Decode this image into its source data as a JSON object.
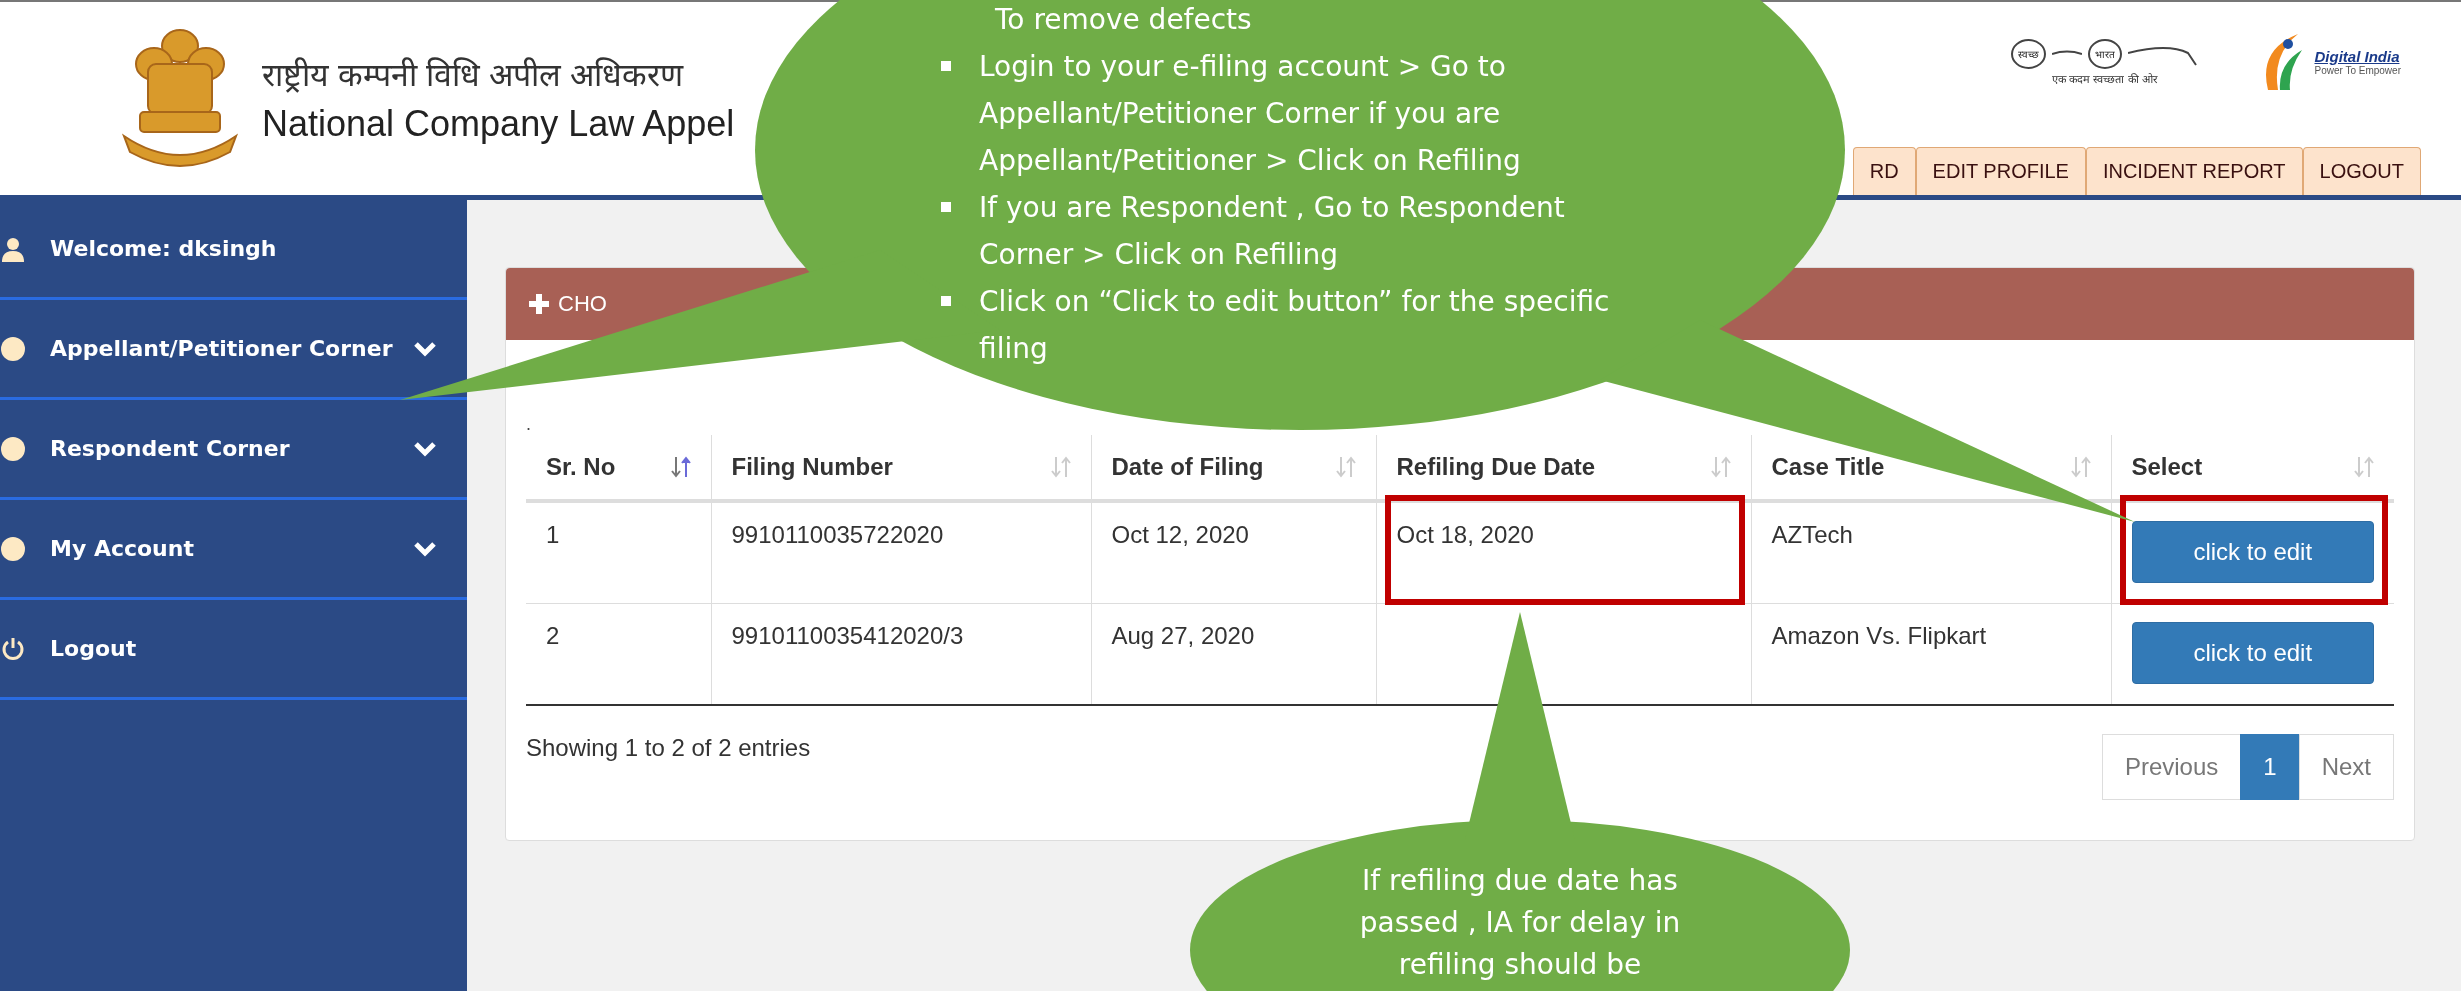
{
  "header": {
    "title_hindi": "राष्ट्रीय कम्पनी विधि अपील अधिकरण",
    "title": "National Company Law Appel",
    "swachh_logo": {
      "left": "स्वच्छ",
      "right": "भारत",
      "tagline": "एक कदम स्वच्छता की ओर"
    },
    "digital_india_logo": {
      "name": "Digital India",
      "tagline": "Power To Empower"
    },
    "nav_tabs": [
      {
        "label": "RD"
      },
      {
        "label": "EDIT PROFILE"
      },
      {
        "label": "INCIDENT REPORT"
      },
      {
        "label": "LOGOUT"
      }
    ]
  },
  "sidebar": {
    "items": [
      {
        "label": "Welcome: dksingh",
        "kind": "user",
        "has_submenu": false
      },
      {
        "label": "Appellant/Petitioner Corner",
        "kind": "menu",
        "has_submenu": true
      },
      {
        "label": "Respondent Corner",
        "kind": "menu",
        "has_submenu": true
      },
      {
        "label": "My Account",
        "kind": "menu",
        "has_submenu": true
      },
      {
        "label": "Logout",
        "kind": "logout",
        "has_submenu": false
      }
    ]
  },
  "panel": {
    "title": "CHO",
    "caption": ".",
    "table": {
      "columns": [
        {
          "label": "Sr. No",
          "sorted": true
        },
        {
          "label": "Filing Number",
          "sorted": false
        },
        {
          "label": "Date of Filing",
          "sorted": false
        },
        {
          "label": "Refiling Due Date",
          "sorted": false
        },
        {
          "label": "Case Title",
          "sorted": false
        },
        {
          "label": "Select",
          "sorted": false
        }
      ],
      "rows": [
        {
          "cells": [
            {
              "kind": "text",
              "text": "1",
              "highlighted": false
            },
            {
              "kind": "text",
              "text": "9910110035722020",
              "highlighted": false
            },
            {
              "kind": "text",
              "text": "Oct 12, 2020",
              "highlighted": false
            },
            {
              "kind": "text",
              "text": "Oct 18, 2020",
              "highlighted": true
            },
            {
              "kind": "text",
              "text": "AZTech",
              "highlighted": false
            },
            {
              "kind": "button",
              "text": "click to edit",
              "highlighted": true
            }
          ]
        },
        {
          "cells": [
            {
              "kind": "text",
              "text": "2",
              "highlighted": false
            },
            {
              "kind": "text",
              "text": "9910110035412020/3",
              "highlighted": false
            },
            {
              "kind": "text",
              "text": "Aug 27, 2020",
              "highlighted": false
            },
            {
              "kind": "text",
              "highlighted": false
            },
            {
              "kind": "text",
              "text": "Amazon Vs. Flipkart",
              "highlighted": false
            },
            {
              "kind": "button",
              "text": "click to edit",
              "highlighted": false
            }
          ]
        }
      ]
    },
    "info": "Showing 1 to 2 of 2 entries",
    "pagination": [
      {
        "label": "Previous",
        "selected": false
      },
      {
        "label": "1",
        "selected": true
      },
      {
        "label": "Next",
        "selected": false
      }
    ]
  },
  "callouts": [
    {
      "title": "To remove defects",
      "bullets": [
        "Login to your e-filing account > Go to Appellant/Petitioner Corner if you are Appellant/Petitioner  > Click on Refiling",
        "If you are Respondent , Go to Respondent Corner > Click on Refiling",
        "Click on “Click to edit button” for the specific filing"
      ]
    },
    {
      "text": "If refiling due date has passed , IA for delay in refiling should be"
    }
  ]
}
